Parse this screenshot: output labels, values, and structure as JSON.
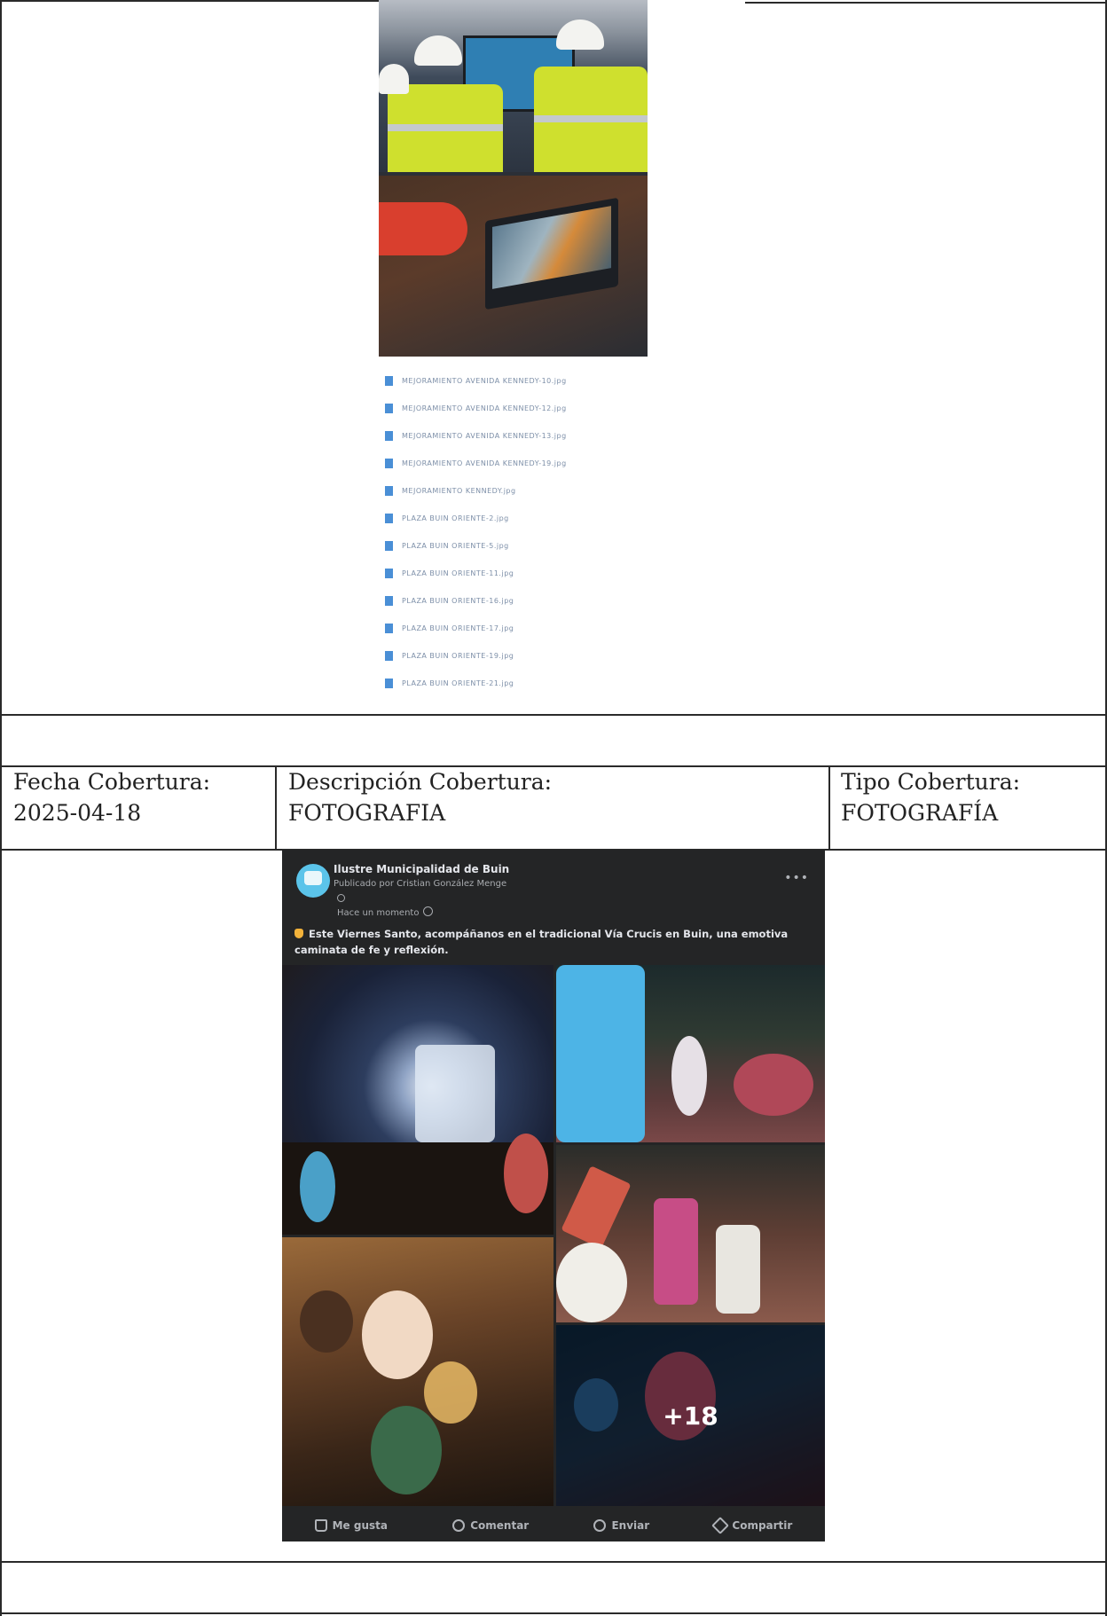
{
  "top_section": {
    "files": [
      "MEJORAMIENTO AVENIDA KENNEDY-10.jpg",
      "MEJORAMIENTO AVENIDA KENNEDY-12.jpg",
      "MEJORAMIENTO AVENIDA KENNEDY-13.jpg",
      "MEJORAMIENTO AVENIDA KENNEDY-19.jpg",
      "MEJORAMIENTO KENNEDY.jpg",
      "PLAZA BUIN ORIENTE-2.jpg",
      "PLAZA BUIN ORIENTE-5.jpg",
      "PLAZA BUIN ORIENTE-11.jpg",
      "PLAZA BUIN ORIENTE-16.jpg",
      "PLAZA BUIN ORIENTE-17.jpg",
      "PLAZA BUIN ORIENTE-19.jpg",
      "PLAZA BUIN ORIENTE-21.jpg"
    ]
  },
  "record": {
    "fecha_label": "Fecha Cobertura:",
    "fecha_value": "2025-04-18",
    "descripcion_label": "Descripción Cobertura:",
    "descripcion_value": "FOTOGRAFIA",
    "tipo_label": "Tipo Cobertura:",
    "tipo_value": "FOTOGRAFÍA"
  },
  "post": {
    "page_name": "Ilustre Municipalidad de Buin",
    "published_by": "Publicado por Cristian González Menge",
    "time": "Hace un momento",
    "text": "Este Viernes Santo, acompáñanos en el tradicional Vía Crucis en Buin, una emotiva caminata de fe y reflexión.",
    "more_photos": "+18",
    "actions": {
      "like": "Me gusta",
      "comment": "Comentar",
      "send": "Enviar",
      "share": "Compartir"
    }
  }
}
